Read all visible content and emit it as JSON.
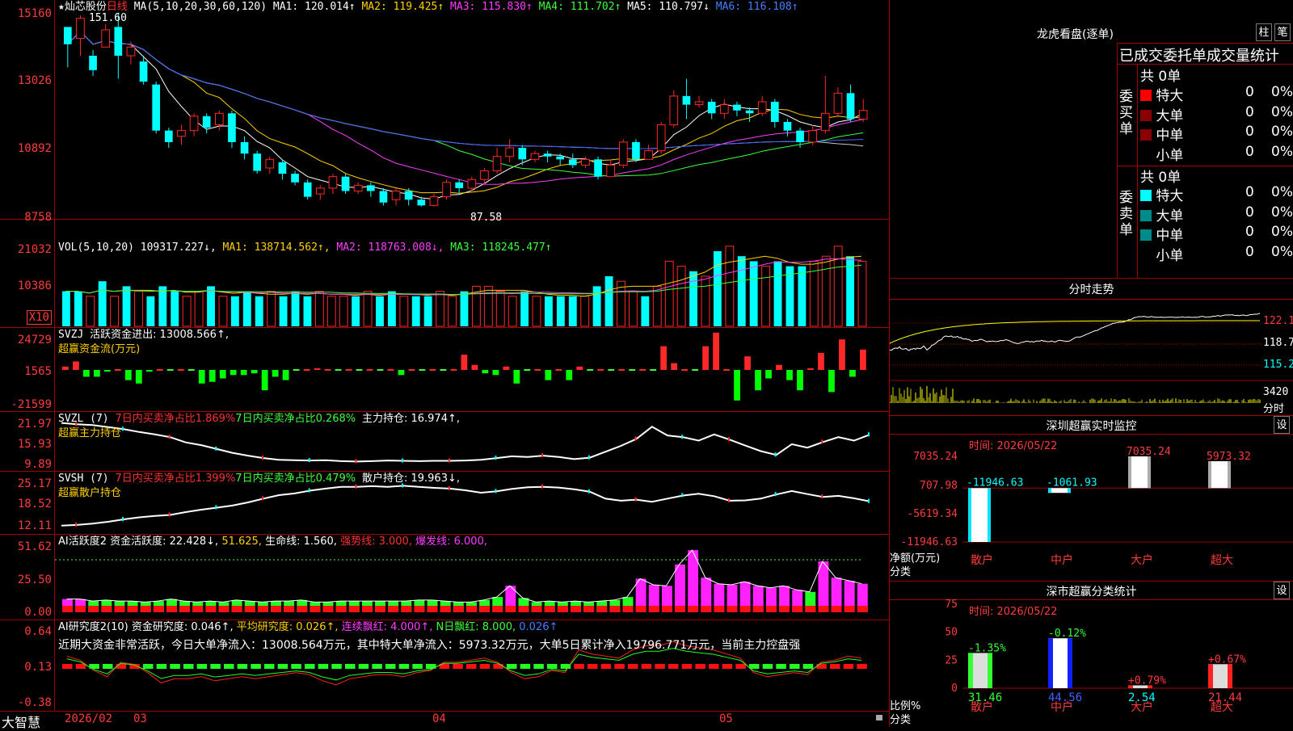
{
  "main": {
    "star": "★",
    "name": "灿芯股份",
    "period": "日线",
    "ma_label": "MA(5,10,20,30,60,120)",
    "ma1": "MA1: 120.014↑",
    "ma2": "MA2: 119.425↑",
    "ma3": "MA3: 115.830↑",
    "ma4": "MA4: 111.702↑",
    "ma5": "MA5: 110.797↓",
    "ma6": "MA6: 116.108↑",
    "axis": [
      "15160",
      "13026",
      "10892",
      "8758"
    ],
    "high_mark": "151.60",
    "low_mark": "87.58",
    "candles": [
      [
        150,
        144,
        146,
        136
      ],
      [
        146,
        153,
        154,
        140
      ],
      [
        140,
        135,
        142,
        133
      ],
      [
        143,
        149,
        151,
        143
      ],
      [
        150,
        140,
        155,
        132
      ],
      [
        140,
        143,
        145,
        137
      ],
      [
        138,
        131,
        140,
        130
      ],
      [
        130,
        114,
        131,
        113
      ],
      [
        114,
        110,
        115,
        108
      ],
      [
        112,
        114,
        116,
        109
      ],
      [
        114,
        119,
        120,
        112
      ],
      [
        119,
        115,
        120,
        113
      ],
      [
        116,
        120,
        121,
        114
      ],
      [
        120,
        110,
        121,
        108
      ],
      [
        110,
        106,
        112,
        104
      ],
      [
        106,
        100,
        107,
        99
      ],
      [
        101,
        104,
        105,
        99
      ],
      [
        103,
        99,
        104,
        97
      ],
      [
        99,
        96,
        100,
        95
      ],
      [
        96,
        91,
        97,
        90
      ],
      [
        92,
        94,
        95,
        90
      ],
      [
        94,
        98,
        99,
        92
      ],
      [
        98,
        93,
        99,
        92
      ],
      [
        93,
        95,
        96,
        92
      ],
      [
        95,
        93,
        96,
        91
      ],
      [
        93,
        89,
        94,
        88
      ],
      [
        90,
        93,
        94,
        88
      ],
      [
        93,
        90,
        94,
        88
      ],
      [
        90,
        88,
        91,
        87.6
      ],
      [
        88,
        91,
        92,
        87.6
      ],
      [
        91,
        96,
        97,
        90
      ],
      [
        96,
        94,
        97,
        92
      ],
      [
        94,
        97,
        98,
        93
      ],
      [
        97,
        100,
        101,
        95
      ],
      [
        100,
        105,
        108,
        99
      ],
      [
        105,
        108,
        111,
        103
      ],
      [
        108,
        104,
        109,
        102
      ],
      [
        104,
        106,
        107,
        103
      ],
      [
        106,
        105,
        107,
        103
      ],
      [
        105,
        104,
        106,
        102
      ],
      [
        104,
        102,
        106,
        101
      ],
      [
        102,
        104,
        105,
        101
      ],
      [
        104,
        98,
        105,
        97
      ],
      [
        98,
        102,
        104,
        98
      ],
      [
        102,
        110,
        111,
        101
      ],
      [
        110,
        104,
        111,
        103
      ],
      [
        104,
        107,
        109,
        104
      ],
      [
        107,
        116,
        117,
        106
      ],
      [
        116,
        126,
        128,
        115
      ],
      [
        126,
        123,
        132,
        118
      ],
      [
        123,
        124,
        126,
        122
      ],
      [
        124,
        120,
        125,
        118
      ],
      [
        120,
        123,
        125,
        118
      ],
      [
        123,
        121,
        124,
        119
      ],
      [
        121,
        120,
        122,
        117
      ],
      [
        120,
        124,
        126,
        119
      ],
      [
        124,
        117,
        125,
        115
      ],
      [
        117,
        114,
        118,
        112
      ],
      [
        114,
        110,
        115,
        108
      ],
      [
        110,
        114,
        116,
        109
      ],
      [
        114,
        120,
        133,
        113
      ],
      [
        120,
        127,
        129,
        119
      ],
      [
        127,
        118,
        130,
        117
      ],
      [
        118,
        121,
        125,
        117
      ]
    ]
  },
  "vol": {
    "label": "VOL(5,10,20)",
    "value": "109317.227↓,",
    "ma1": "MA1: 138714.562↑,",
    "ma2": "MA2: 118763.008↓,",
    "ma3": "MA3: 118245.477↑",
    "axis": [
      "21032",
      "10386"
    ],
    "unit": "X10",
    "bars": [
      7,
      7,
      6,
      9,
      6,
      8,
      7,
      6,
      8,
      7,
      6,
      7,
      8,
      6,
      6,
      7,
      6,
      7,
      6,
      7,
      6,
      7,
      6,
      6,
      6,
      7,
      6,
      7,
      6,
      6,
      6,
      7,
      6,
      7,
      8,
      8,
      7,
      6,
      7,
      6,
      6,
      6,
      6,
      6,
      8,
      10,
      9,
      7,
      6,
      8,
      13,
      12,
      11,
      10,
      15,
      16,
      14,
      13,
      12,
      13,
      12,
      12,
      13,
      14,
      16,
      14,
      13
    ]
  },
  "svzj": {
    "label": "SVZJ",
    "text": "活跃资金进出: 13008.566↑,",
    "sub": "超赢资金流(万元)",
    "axis": [
      "24729",
      "1565",
      "-21599"
    ],
    "vals": [
      2,
      5,
      -4,
      -4,
      -1,
      0,
      -6,
      -8,
      -1,
      0,
      0,
      0,
      0,
      -8,
      -7,
      -5,
      -3,
      -3,
      -2,
      -12,
      -4,
      -6,
      0,
      0,
      1,
      0,
      0,
      0,
      0,
      0,
      0,
      0,
      -3,
      0,
      0,
      0,
      0,
      0,
      9,
      3,
      -2,
      -3,
      2,
      -8,
      0,
      0,
      -6,
      0,
      -6,
      2,
      0,
      0,
      0,
      0,
      0,
      0,
      0,
      14,
      4,
      0,
      0,
      14,
      22,
      0,
      -18,
      8,
      -12,
      -5,
      3,
      -6,
      -12,
      1,
      10,
      -13,
      18,
      -4,
      12
    ]
  },
  "svzl": {
    "label": "SVZL (7)",
    "r1": "7日内买卖净占比1.869%",
    "g1": "7日内买卖净占比0.268%",
    "text": "主力持仓: 16.974↑,",
    "sub": "超赢主力持仓",
    "axis": [
      "21.97",
      "15.93",
      "9.89"
    ],
    "pts": [
      21.6,
      21.2,
      21,
      20.4,
      19.8,
      19,
      18.3,
      17.5,
      16,
      15.2,
      14.1,
      13,
      12.2,
      11.5,
      11,
      10.9,
      10.8,
      10.9,
      10.6,
      10.5,
      10.6,
      10.8,
      10.7,
      10.6,
      10.7,
      10.7,
      10.8,
      11,
      11.5,
      12,
      11.8,
      12.2,
      11.8,
      11.2,
      11.6,
      13.3,
      15,
      17,
      20.5,
      18,
      17.5,
      16.5,
      18.3,
      16.8,
      15.1,
      13.5,
      12.4,
      15.5,
      14.5,
      16.1,
      17.5,
      16.5,
      18.2
    ]
  },
  "svsh": {
    "label": "SVSH (7)",
    "r1": "7日内买卖净占比1.399%",
    "g1": "7日内买卖净占比0.479%",
    "text": "散户持仓: 19.963↓,",
    "sub": "超赢散户持仓",
    "axis": [
      "25.17",
      "18.52",
      "12.11"
    ],
    "pts": [
      12.4,
      12.6,
      13,
      13.5,
      14.2,
      14.8,
      15.2,
      15.5,
      16.3,
      17,
      17.6,
      18.2,
      19.1,
      20.2,
      21.2,
      21.7,
      22.5,
      23.1,
      23.6,
      23.6,
      23.8,
      23.6,
      23.9,
      23.6,
      23.3,
      23.1,
      22.6,
      21.9,
      22.3,
      23,
      23.5,
      23.6,
      23.4,
      22.9,
      22.2,
      20.2,
      19.6,
      19.9,
      19.3,
      20.2,
      21.1,
      21.6,
      20.9,
      19.6,
      19.7,
      20.2,
      21.4,
      22.4,
      21.5,
      20.7,
      21,
      20.3,
      19.4
    ]
  },
  "ai1": {
    "label": "AI活跃度2",
    "text": "资金活跃度: 22.428↓,",
    "v2": "51.625,",
    "v3": "生命线: 1.560,",
    "v4": "强势线: 3.000,",
    "v5": "爆发线: 6.000,",
    "axis": [
      "51.62",
      "25.50",
      "0.00"
    ],
    "bars": [
      [
        1,
        13
      ],
      [
        1,
        13
      ],
      [
        0,
        11
      ],
      [
        0,
        12
      ],
      [
        0,
        11
      ],
      [
        0,
        11
      ],
      [
        0,
        10
      ],
      [
        0,
        11
      ],
      [
        0,
        13
      ],
      [
        0,
        11
      ],
      [
        0,
        10
      ],
      [
        0,
        11
      ],
      [
        0,
        10
      ],
      [
        0,
        12
      ],
      [
        0,
        11
      ],
      [
        0,
        10
      ],
      [
        0,
        11
      ],
      [
        0,
        11
      ],
      [
        0,
        12
      ],
      [
        0,
        10
      ],
      [
        0,
        10
      ],
      [
        0,
        11
      ],
      [
        0,
        11
      ],
      [
        0,
        11
      ],
      [
        0,
        11
      ],
      [
        0,
        11
      ],
      [
        0,
        11
      ],
      [
        0,
        12
      ],
      [
        0,
        12
      ],
      [
        0,
        11
      ],
      [
        0,
        10
      ],
      [
        0,
        10
      ],
      [
        0,
        12
      ],
      [
        0,
        15
      ],
      [
        1,
        26
      ],
      [
        0,
        14
      ],
      [
        0,
        10
      ],
      [
        0,
        11
      ],
      [
        0,
        10
      ],
      [
        0,
        11
      ],
      [
        0,
        10
      ],
      [
        0,
        11
      ],
      [
        0,
        12
      ],
      [
        0,
        15
      ],
      [
        1,
        33
      ],
      [
        1,
        27
      ],
      [
        1,
        26
      ],
      [
        1,
        47
      ],
      [
        1,
        61
      ],
      [
        1,
        34
      ],
      [
        1,
        28
      ],
      [
        1,
        27
      ],
      [
        1,
        30
      ],
      [
        1,
        26
      ],
      [
        1,
        24
      ],
      [
        1,
        26
      ],
      [
        1,
        22
      ],
      [
        0,
        20
      ],
      [
        1,
        50
      ],
      [
        1,
        34
      ],
      [
        1,
        31
      ],
      [
        1,
        28
      ]
    ]
  },
  "ai2": {
    "label": "AI研究度2(10)",
    "text": "资金研究度: 0.046↑,",
    "v2": "平均研究度: 0.026↑,",
    "v3": "连续飘红: 4.000↑,",
    "v4": "N日飘红: 8.000,",
    "v5": "0.026↑",
    "desc": "近期大资金非常活跃，今日大单净流入：13008.564万元，其中特大单净流入：5973.32万元，大单5日累计净入19796.771万元，当前主力控盘强",
    "axis": [
      "0.64",
      "0.13",
      "-0.38"
    ],
    "vals": [
      0.05,
      0.03,
      -0.02,
      -0.05,
      0.02,
      0.01,
      -0.03,
      -0.08,
      -0.06,
      -0.06,
      -0.05,
      -0.07,
      -0.06,
      -0.05,
      -0.06,
      -0.05,
      -0.04,
      -0.03,
      -0.04,
      -0.07,
      -0.09,
      -0.06,
      -0.05,
      -0.04,
      -0.04,
      -0.05,
      -0.03,
      -0.02,
      0.02,
      0.02,
      0.03,
      0.04,
      0.02,
      -0.03,
      -0.06,
      -0.05,
      -0.02,
      -0.03,
      0.08,
      0.06,
      0.05,
      0.04,
      0.08,
      0.1,
      0.1,
      0.12,
      0.1,
      0.09,
      0.08,
      0.06,
      0.04,
      -0.03,
      -0.05,
      -0.04,
      -0.03,
      -0.04,
      0.02,
      0.03,
      0.05,
      0.04
    ]
  },
  "xaxis": {
    "logo": "大智慧",
    "d1": "2026/02",
    "d2": "03",
    "d3": "04",
    "d4": "05"
  },
  "lhb": {
    "title": "龙虎看盘(逐单)",
    "btn1": "柱",
    "btn2": "笔",
    "tab": "已成交委托单成交量统计",
    "buy_total": "共 0单",
    "sell_total": "共 0单",
    "buy_label": "委买单",
    "sell_label": "委卖单",
    "rows": [
      "特大",
      "大单",
      "中单",
      "小单"
    ],
    "zero": "0",
    "pct": "0%"
  },
  "fs": {
    "title": "分时走势",
    "p1": "122.1",
    "p2": "118.7",
    "p3": "115.2",
    "v": "3420",
    "unit": "分时"
  },
  "szjk": {
    "title": "深圳超赢实时监控",
    "btn": "设",
    "time": "时间: 2026/05/22",
    "axis": [
      "7035.24",
      "707.98",
      "-5619.34",
      "-11946.63"
    ],
    "ylabel": "净额(万元)",
    "xlabel": "分类",
    "cats": [
      "散户",
      "中户",
      "大户",
      "超大"
    ],
    "vals": [
      "-11946.63",
      "-1061.93",
      "7035.24",
      "5973.32"
    ],
    "nums": [
      -11946.63,
      -1061.93,
      7035.24,
      5973.32
    ]
  },
  "fltj": {
    "title": "深市超赢分类统计",
    "btn": "设",
    "time": "时间: 2026/05/22",
    "axis": [
      "75",
      "50",
      "25",
      "0"
    ],
    "ylabel": "比例%",
    "xlabel": "分类",
    "cats": [
      "散户",
      "中户",
      "大户",
      "超大"
    ],
    "pcts": [
      "31.46",
      "44.56",
      "2.54",
      "21.44"
    ],
    "chg": [
      "-1.35%",
      "-0.12%",
      "+0.79%",
      "+0.67%"
    ],
    "nums": [
      31.46,
      44.56,
      2.54,
      21.44
    ]
  }
}
